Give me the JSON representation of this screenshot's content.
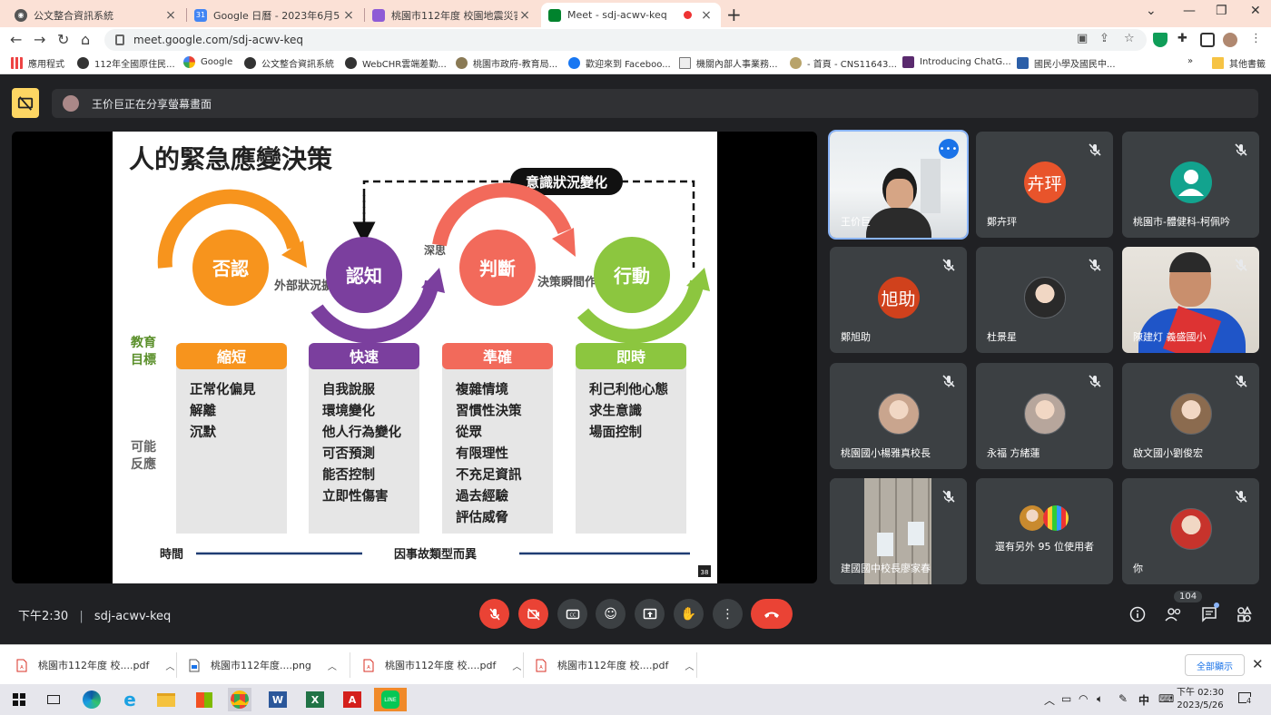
{
  "browser": {
    "tabs": [
      {
        "title": "公文整合資訊系統",
        "active": false
      },
      {
        "title": "Google 日曆 - 2023年6月5日當週",
        "active": false
      },
      {
        "title": "桃園市112年度 校園地震災害防範",
        "active": false
      },
      {
        "title": "Meet - sdj-acwv-keq",
        "active": true
      }
    ],
    "url": "meet.google.com/sdj-acwv-keq",
    "bookmarks": [
      "應用程式",
      "112年全國原住民...",
      "Google",
      "公文整合資訊系統",
      "WebCHR雲端差勤...",
      "桃園市政府-教育局...",
      "歡迎來到 Faceboo...",
      "機關內部人事業務...",
      "- 首頁 - CNS11643...",
      "Introducing ChatG...",
      "國民小學及國民中..."
    ],
    "other_bookmarks": "其他書籤"
  },
  "meet": {
    "presenting_text": "王价巨正在分享螢幕畫面",
    "meeting_time": "下午2:30",
    "meeting_code": "sdj-acwv-keq",
    "participant_count": "104",
    "participants": [
      {
        "name": "王价巨",
        "type": "video",
        "selected": true,
        "muted": false
      },
      {
        "name": "鄭卉玶",
        "type": "initials",
        "initials": "卉玶",
        "color": "#e8542b",
        "muted": true
      },
      {
        "name": "桃園市-體健科-柯佩吟",
        "type": "generic",
        "color": "#12a38e",
        "muted": true
      },
      {
        "name": "鄭旭助",
        "type": "initials",
        "initials": "旭助",
        "color": "#d0411c",
        "muted": true
      },
      {
        "name": "杜景星",
        "type": "photo",
        "color": "#2a2a2a",
        "muted": true
      },
      {
        "name": "陳建灯 義盛國小",
        "type": "video",
        "muted": true
      },
      {
        "name": "桃園國小楊雅真校長",
        "type": "photo",
        "color": "#c9a58e",
        "muted": true
      },
      {
        "name": "永福 方緒蓮",
        "type": "photo",
        "color": "#b7a69c",
        "muted": true
      },
      {
        "name": "啟文國小劉俊宏",
        "type": "photo",
        "color": "#8b6b4f",
        "muted": true
      },
      {
        "name": "建國國中校長廖家春",
        "type": "video",
        "muted": true
      },
      {
        "name": "還有另外 95 位使用者",
        "type": "group",
        "muted": false
      },
      {
        "name": "你",
        "type": "photo",
        "color": "#c7332c",
        "muted": true
      }
    ]
  },
  "slide": {
    "title": "人的緊急應變決策",
    "feedback_label": "意識狀況變化",
    "stages": [
      "否認",
      "認知",
      "判斷",
      "行動"
    ],
    "arrow_labels": {
      "external": "外部狀況擴大",
      "deep": "深思",
      "instant": "決策瞬間作為"
    },
    "row_labels": {
      "education": "教育目標",
      "reactions": "可能反應"
    },
    "goals": [
      "縮短",
      "快速",
      "準確",
      "即時"
    ],
    "reactions": [
      [
        "正常化偏見",
        "解離",
        "沉默"
      ],
      [
        "自我說服",
        "環境變化",
        "他人行為變化",
        "可否預測",
        "能否控制",
        "立即性傷害"
      ],
      [
        "複雜情境",
        "習慣性決策",
        "從眾",
        "有限理性",
        "不充足資訊",
        "過去經驗",
        "評估威脅"
      ],
      [
        "利己利他心態",
        "求生意識",
        "場面控制"
      ]
    ],
    "time_label": "時間",
    "time_note": "因事故類型而異",
    "page_number": "38"
  },
  "downloads": {
    "items": [
      "桃園市112年度 校....pdf",
      "桃園市112年度....png",
      "桃園市112年度 校....pdf",
      "桃園市112年度 校....pdf"
    ],
    "show_all": "全部顯示"
  },
  "taskbar": {
    "ime": "中",
    "time": "下午 02:30",
    "date": "2023/5/26",
    "notifications": "4"
  },
  "colors": {
    "denial": "#f7941d",
    "cognition": "#7b3f9e",
    "judgment": "#f26a5b",
    "action": "#8cc63f",
    "meet_red": "#ea4335"
  }
}
